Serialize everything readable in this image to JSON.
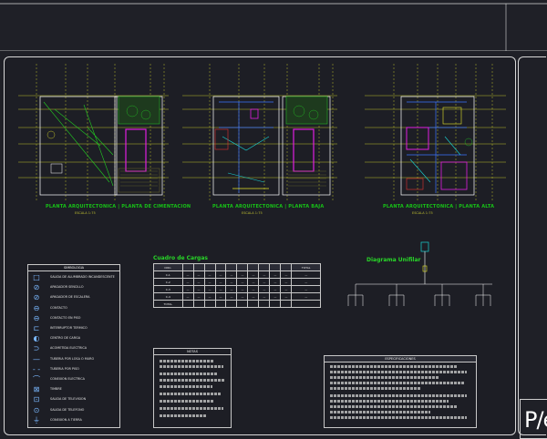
{
  "sheet": {
    "plans": [
      {
        "caption": "PLANTA ARQUITECTONICA | PLANTA DE CIMENTACION",
        "scale": "ESCALA 1:75"
      },
      {
        "caption": "PLANTA ARQUITECTONICA | PLANTA BAJA",
        "scale": "ESCALA 1:75"
      },
      {
        "caption": "PLANTA ARQUITECTONICA | PLANTA ALTA",
        "scale": "ESCALA 1:75"
      }
    ],
    "legend": {
      "title": "SIMBOLOGIA",
      "items": [
        {
          "icon": "square-icon",
          "glyph": "□",
          "label": "SALIDA DE ALUMBRADO INCANDESCENTE"
        },
        {
          "icon": "outlet-icon",
          "glyph": "⊘",
          "label": "APAGADOR SENCILLO"
        },
        {
          "icon": "outlet-icon",
          "glyph": "⊘",
          "label": "APAGADOR DE ESCALERA"
        },
        {
          "icon": "contact-icon",
          "glyph": "⊖",
          "label": "CONTACTO"
        },
        {
          "icon": "contact-icon",
          "glyph": "⊖",
          "label": "CONTACTO EN PISO"
        },
        {
          "icon": "interruptor-icon",
          "glyph": "⊏",
          "label": "INTERRUPTOR TERMICO"
        },
        {
          "icon": "center-icon",
          "glyph": "◐",
          "label": "CENTRO DE CARGA"
        },
        {
          "icon": "meter-icon",
          "glyph": "⊃",
          "label": "ACOMETIDA ELECTRICA"
        },
        {
          "icon": "line-icon",
          "glyph": "—",
          "label": "TUBERIA POR LOSA O MURO"
        },
        {
          "icon": "line-dashed-icon",
          "glyph": "- -",
          "label": "TUBERIA POR PISO"
        },
        {
          "icon": "arc-icon",
          "glyph": "⌒",
          "label": "CONEXION ELECTRICA"
        },
        {
          "icon": "bell-icon",
          "glyph": "⊠",
          "label": "TIMBRE"
        },
        {
          "icon": "tv-icon",
          "glyph": "⊡",
          "label": "SALIDA DE TELEVISION"
        },
        {
          "icon": "phone-icon",
          "glyph": "⊙",
          "label": "SALIDA DE TELEFONO"
        },
        {
          "icon": "ground-icon",
          "glyph": "⏚",
          "label": "CONEXION A TIERRA"
        }
      ]
    },
    "cargas": {
      "title": "Cuadro de Cargas",
      "headers": [
        "CIRC.",
        "",
        "",
        "",
        "",
        "",
        "",
        "",
        "",
        "",
        "",
        "TOTAL"
      ],
      "rows": [
        [
          "C-1",
          "—",
          "—",
          "—",
          "—",
          "—",
          "—",
          "—",
          "—",
          "—",
          "—",
          "—"
        ],
        [
          "C-2",
          "—",
          "—",
          "—",
          "—",
          "—",
          "—",
          "—",
          "—",
          "—",
          "—",
          "—"
        ],
        [
          "C-3",
          "—",
          "—",
          "—",
          "—",
          "—",
          "—",
          "—",
          "—",
          "—",
          "—",
          "—"
        ],
        [
          "C-4",
          "—",
          "—",
          "—",
          "—",
          "—",
          "—",
          "—",
          "—",
          "—",
          "—",
          "—"
        ],
        [
          "TOTAL",
          "",
          "",
          "",
          "",
          "",
          "",
          "",
          "",
          "",
          "",
          ""
        ]
      ]
    },
    "diagram": {
      "title": "Diagrama Unifilar"
    },
    "notes": {
      "title": "NOTAS"
    },
    "specs": {
      "title": "ESPECIFICACIONES"
    },
    "stamp": {
      "code": "P/e"
    }
  },
  "colors": {
    "background": "#1f2027",
    "lines": "#d8d8d8",
    "green": "#22cc22",
    "cyan": "#19d4d4",
    "magenta": "#e01ee0",
    "yellow": "#e6e62a",
    "blue": "#3c73ff",
    "red": "#e33131"
  }
}
